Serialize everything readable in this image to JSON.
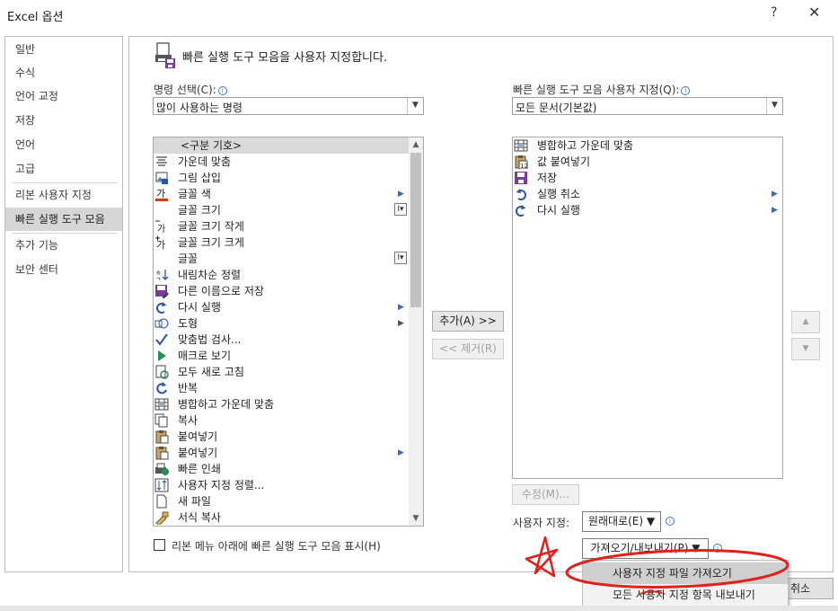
{
  "window": {
    "title": "Excel 옵션",
    "help": "?",
    "close": "✕"
  },
  "nav": {
    "items": [
      {
        "label": "일반"
      },
      {
        "label": "수식"
      },
      {
        "label": "언어 교정"
      },
      {
        "label": "저장"
      },
      {
        "label": "언어"
      },
      {
        "label": "고급"
      },
      {
        "label": "리본 사용자 지정"
      },
      {
        "label": "빠른 실행 도구 모음"
      },
      {
        "label": "추가 기능"
      },
      {
        "label": "보안 센터"
      }
    ],
    "selected": "빠른 실행 도구 모음"
  },
  "header": {
    "text": "빠른 실행 도구 모음을 사용자 지정합니다."
  },
  "left": {
    "label": "명령 선택(C):",
    "combo_value": "많이 사용하는 명령",
    "commands": [
      {
        "label": "<구분 기호>",
        "icon": "none"
      },
      {
        "label": "가운데 맞춤",
        "icon": "center-align-icon"
      },
      {
        "label": "그림 삽입",
        "icon": "picture-icon"
      },
      {
        "label": "글꼴 색",
        "icon": "font-color-icon",
        "submenu": true
      },
      {
        "label": "글꼴 크기",
        "icon": "none",
        "sizebox": "I▾"
      },
      {
        "label": "글꼴 크기 작게",
        "icon": "font-decrease-icon"
      },
      {
        "label": "글꼴 크기 크게",
        "icon": "font-increase-icon"
      },
      {
        "label": "글꼴",
        "icon": "none",
        "sizebox": "I▾"
      },
      {
        "label": "내림차순 정렬",
        "icon": "sort-desc-icon"
      },
      {
        "label": "다른 이름으로 저장",
        "icon": "save-as-icon"
      },
      {
        "label": "다시 실행",
        "icon": "redo-icon",
        "submenu": true
      },
      {
        "label": "도형",
        "icon": "shapes-icon",
        "submenu": true
      },
      {
        "label": "맞춤법 검사...",
        "icon": "spelling-icon"
      },
      {
        "label": "매크로 보기",
        "icon": "macro-icon"
      },
      {
        "label": "모두 새로 고침",
        "icon": "refresh-all-icon"
      },
      {
        "label": "반복",
        "icon": "repeat-icon"
      },
      {
        "label": "병합하고 가운데 맞춤",
        "icon": "merge-center-icon"
      },
      {
        "label": "복사",
        "icon": "copy-icon"
      },
      {
        "label": "붙여넣기",
        "icon": "paste-icon"
      },
      {
        "label": "붙여넣기",
        "icon": "paste-icon",
        "submenu": true
      },
      {
        "label": "빠른 인쇄",
        "icon": "quick-print-icon"
      },
      {
        "label": "사용자 지정 정렬...",
        "icon": "custom-sort-icon"
      },
      {
        "label": "새 파일",
        "icon": "new-file-icon"
      },
      {
        "label": "서식 복사",
        "icon": "format-painter-icon"
      }
    ],
    "checkbox_label": "리본 메뉴 아래에 빠른 실행 도구 모음 표시(H)"
  },
  "middle": {
    "add_label": "추가(A) >>",
    "remove_label": "<< 제거(R)"
  },
  "right": {
    "label": "빠른 실행 도구 모음 사용자 지정(Q):",
    "combo_value": "모든 문서(기본값)",
    "items": [
      {
        "label": "병합하고 가운데 맞춤",
        "icon": "merge-center-icon"
      },
      {
        "label": "값 붙여넣기",
        "icon": "paste-values-icon"
      },
      {
        "label": "저장",
        "icon": "save-icon"
      },
      {
        "label": "실행 취소",
        "icon": "undo-icon",
        "submenu": true
      },
      {
        "label": "다시 실행",
        "icon": "redo-icon",
        "submenu": true
      }
    ],
    "modify_label": "수정(M)...",
    "customize_label": "사용자 지정:",
    "reset_label": "원래대로(E) ▼",
    "import_export_label": "가져오기/내보내기(P) ▼"
  },
  "dropdown_menu": {
    "items": [
      {
        "label": "사용자 지정 파일 가져오기"
      },
      {
        "label": "모든 사용자 지정 항목 내보내기"
      }
    ]
  },
  "footer": {
    "cancel_label": "취소"
  },
  "colors": {
    "selection": "#d6d6d6",
    "accent_blue": "#2b579a",
    "annotation_red": "#e0201a"
  }
}
